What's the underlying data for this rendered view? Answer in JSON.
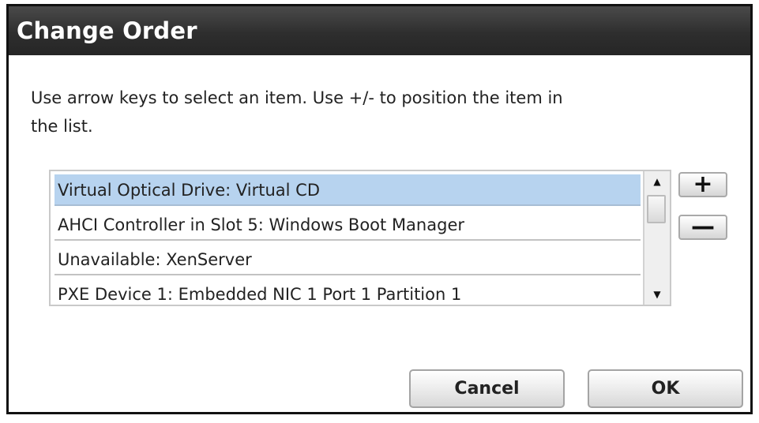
{
  "dialog": {
    "title": "Change Order",
    "instructions": "Use arrow keys to select an item. Use +/- to position the item in the list."
  },
  "list": {
    "items": [
      {
        "label": "Virtual Optical Drive: Virtual CD",
        "selected": true
      },
      {
        "label": "AHCI Controller in Slot 5: Windows Boot Manager",
        "selected": false
      },
      {
        "label": "Unavailable: XenServer",
        "selected": false
      },
      {
        "label": "PXE Device 1: Embedded NIC 1 Port 1 Partition 1",
        "selected": false
      }
    ]
  },
  "controls": {
    "plus_label": "+",
    "minus_label": "—",
    "cancel_label": "Cancel",
    "ok_label": "OK"
  },
  "colors": {
    "titlebar": "#2e2e2e",
    "selection": "#b7d3ef"
  }
}
